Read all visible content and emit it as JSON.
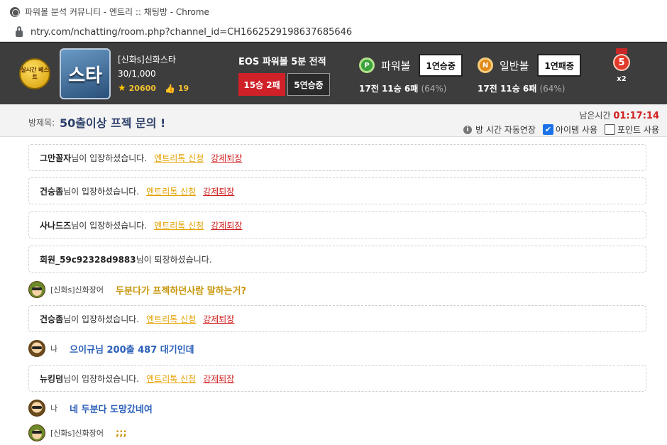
{
  "window": {
    "title": "파워볼 분석 커뮤니티 - 엔트리 :: 채팅방 - Chrome",
    "url": "ntry.com/nchatting/room.php?channel_id=CH1662529198637685646"
  },
  "header": {
    "best_badge": "실시간 베스트",
    "thumb_text": "스타",
    "room_name": "[신화s]신화스타",
    "member_count": "30/1,000",
    "stars": "20600",
    "likes": "19",
    "eos_title": "EOS 파워볼 5분 전적",
    "eos_record": "15승 2패",
    "eos_streak": "5연승중",
    "powerball": {
      "icon": "P",
      "label": "파워볼",
      "streak": "1연승중",
      "rec_total": "17전",
      "rec_win": "11승",
      "rec_lose": "6패",
      "rec_pct": "(64%)"
    },
    "normalball": {
      "icon": "N",
      "label": "일반볼",
      "streak": "1연패중",
      "rec_total": "17전",
      "rec_win": "11승",
      "rec_lose": "6패",
      "rec_pct": "(64%)"
    },
    "medal": {
      "number": "5",
      "multiplier": "x2"
    }
  },
  "room": {
    "label": "방제목:",
    "title": "50출이상 프젝 문의 !",
    "timer_label": "남은시간",
    "timer_value": "01:17:14",
    "auto_extend": "방 시간 자동연장",
    "use_item": "아이템 사용",
    "use_point": "포인트 사용"
  },
  "chat": {
    "enter_text": "님이 입장하셨습니다.",
    "leave_text": "님이 퇴장하셨습니다.",
    "request": "엔트리톡 신청",
    "kick": "강제퇴장",
    "m1": {
      "nick": "그만꼴자"
    },
    "m2": {
      "nick": "건승좀"
    },
    "m3": {
      "nick": "사나드즈"
    },
    "m4": {
      "nick": "회원_59c92328d9883"
    },
    "m5": {
      "who": "[신화s]신화장어",
      "text": "두분다가 프젝하던사람 말하는거?"
    },
    "m6": {
      "nick": "건승좀"
    },
    "m7": {
      "who": "나",
      "text": "으이규님 200출 487 대기인데"
    },
    "m8": {
      "nick": "뉴킹덤"
    },
    "m9": {
      "who": "나",
      "text": "네 두분다 도망갔네여"
    },
    "m10": {
      "who": "[신화s]신화장어",
      "text": ";;;"
    }
  }
}
